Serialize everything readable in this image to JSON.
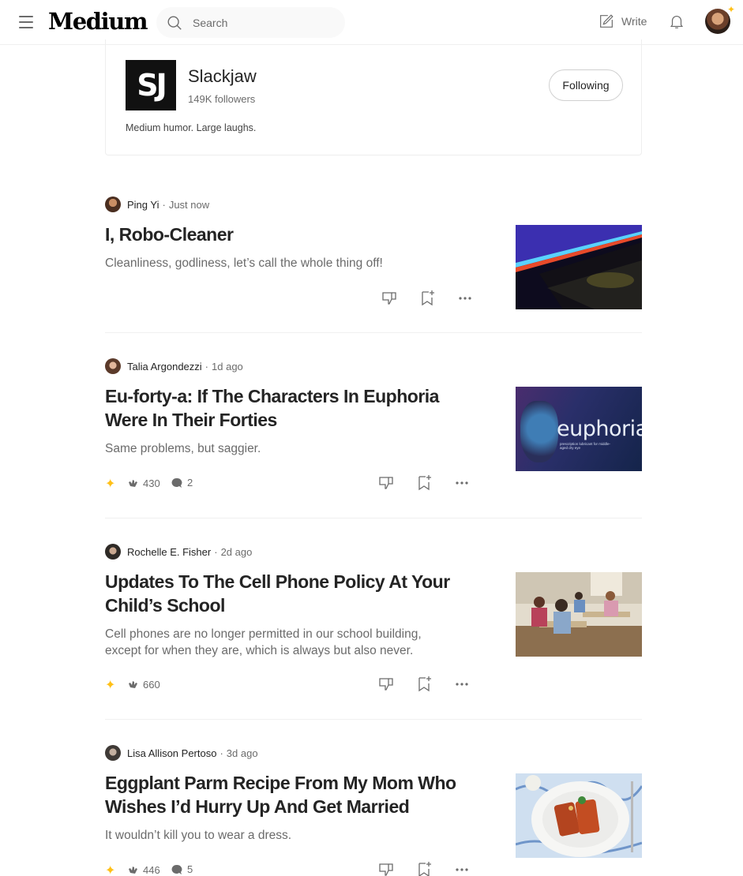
{
  "nav": {
    "logo": "Medium",
    "search_placeholder": "Search",
    "write_label": "Write"
  },
  "publication": {
    "logo_text": "SJ",
    "name": "Slackjaw",
    "followers": "149K followers",
    "description": "Medium humor. Large laughs.",
    "follow_label": "Following"
  },
  "articles": [
    {
      "author": "Ping Yi",
      "time": "Just now",
      "title": "I, Robo-Cleaner",
      "subtitle": "Cleanliness, godliness, let’s call the whole thing off!"
    },
    {
      "author": "Talia Argondezzi",
      "time": "1d ago",
      "title": "Eu-forty-a: If The Characters In Euphoria Were In Their Forties",
      "subtitle": "Same problems, but saggier.",
      "claps": "430",
      "responses": "2",
      "thumb_text": "euphoria",
      "thumb_caption": "prescription lubricant for middle-aged dry eye"
    },
    {
      "author": "Rochelle E. Fisher",
      "time": "2d ago",
      "title": "Updates To The Cell Phone Policy At Your Child’s School",
      "subtitle": "Cell phones are no longer permitted in our school building, except for when they are, which is always but also never.",
      "claps": "660"
    },
    {
      "author": "Lisa Allison Pertoso",
      "time": "3d ago",
      "title": "Eggplant Parm Recipe From My Mom Who Wishes I’d Hurry Up And Get Married",
      "subtitle": "It wouldn’t kill you to wear a dress.",
      "claps": "446",
      "responses": "5"
    }
  ],
  "colors": {
    "accent_star": "#ffc017",
    "text_primary": "#242424",
    "text_secondary": "#6b6b6b"
  }
}
